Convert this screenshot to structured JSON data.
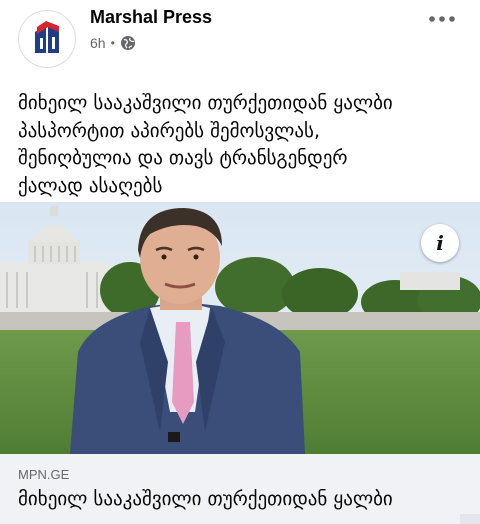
{
  "post": {
    "page_name": "Marshal Press",
    "time": "6h",
    "separator": "•",
    "privacy_icon": "globe-icon",
    "more_icon": "more-dots-icon",
    "text": "მიხეილ სააკაშვილი თურქეთიდან ყალბი\nპასპორტით აპირებს შემოსვლას,\nშენიღბულია და თავს ტრანსგენდერ\nქალად ასაღებს",
    "info_label": "i"
  },
  "link_preview": {
    "domain": "MPN.GE",
    "title": "მიხეილ სააკაშვილი თურქეთიდან ყალბი"
  },
  "colors": {
    "logo_blue": "#1f3d8c",
    "logo_red": "#d7262b",
    "meta_gray": "#65676b",
    "preview_bg": "#f0f2f5"
  }
}
